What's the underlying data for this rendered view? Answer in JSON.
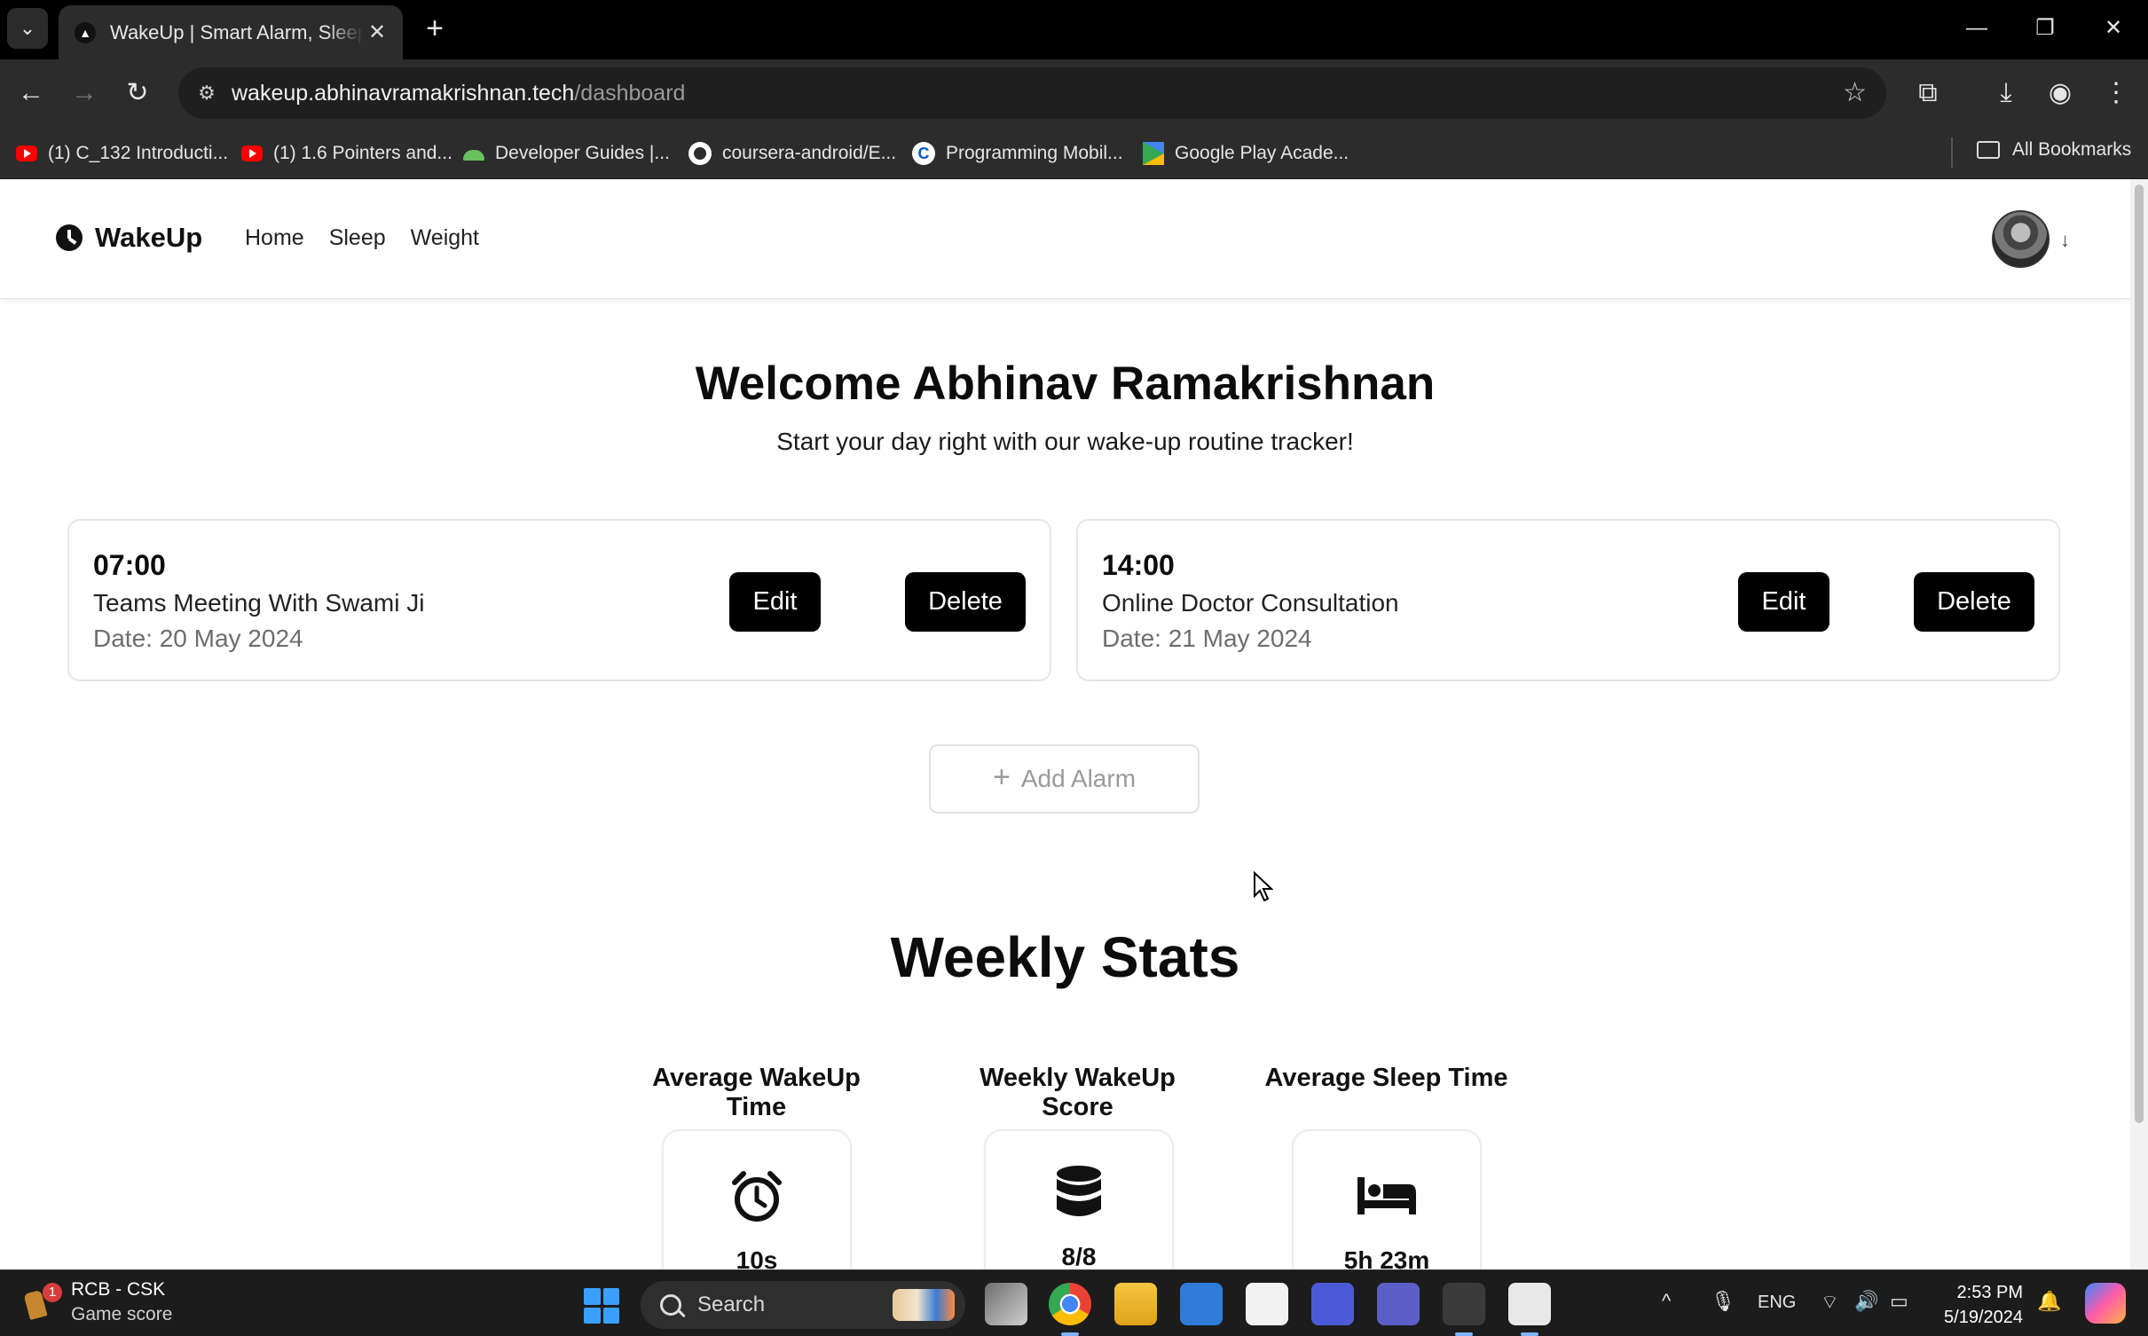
{
  "browser": {
    "tab_title": "WakeUp | Smart Alarm, Sleep and Weight Tracker",
    "new_tab_label": "+",
    "url_host": "wakeup.abhinavramakrishnan.tech",
    "url_path": "/dashboard",
    "bookmarks": [
      {
        "label": "(1) C_132 Introducti...",
        "icon": "youtube-icon"
      },
      {
        "label": "(1) 1.6 Pointers and...",
        "icon": "youtube-icon"
      },
      {
        "label": "Developer Guides |...",
        "icon": "android-icon"
      },
      {
        "label": "coursera-android/E...",
        "icon": "github-icon"
      },
      {
        "label": "Programming Mobil...",
        "icon": "coursera-icon"
      },
      {
        "label": "Google Play Acade...",
        "icon": "google-play-icon"
      }
    ],
    "all_bookmarks_label": "All Bookmarks"
  },
  "navbar": {
    "brand": "WakeUp",
    "links": [
      "Home",
      "Sleep",
      "Weight"
    ]
  },
  "hero": {
    "title": "Welcome Abhinav Ramakrishnan",
    "subtitle": "Start your day right with our wake-up routine tracker!"
  },
  "alarms": [
    {
      "time": "07:00",
      "label": "Teams Meeting With Swami Ji",
      "date": "Date: 20 May 2024",
      "edit_label": "Edit",
      "delete_label": "Delete"
    },
    {
      "time": "14:00",
      "label": "Online Doctor Consultation",
      "date": "Date: 21 May 2024",
      "edit_label": "Edit",
      "delete_label": "Delete"
    }
  ],
  "add_alarm_label": "Add Alarm",
  "weekly": {
    "title": "Weekly Stats",
    "stats": [
      {
        "label": "Average WakeUp Time",
        "value": "10s",
        "icon": "alarm-clock-icon"
      },
      {
        "label": "Weekly WakeUp Score",
        "value": "8/8",
        "icon": "database-icon"
      },
      {
        "label": "Average Sleep Time",
        "value": "5h 23m",
        "icon": "bed-icon"
      }
    ]
  },
  "taskbar": {
    "widget_title": "RCB - CSK",
    "widget_subtitle": "Game score",
    "widget_badge": "1",
    "search_label": "Search",
    "language": "ENG",
    "time": "2:53 PM",
    "date": "5/19/2024"
  },
  "colors": {
    "accent": "#000000",
    "page_bg": "#ffffff",
    "muted_text": "#6d6d6d"
  }
}
